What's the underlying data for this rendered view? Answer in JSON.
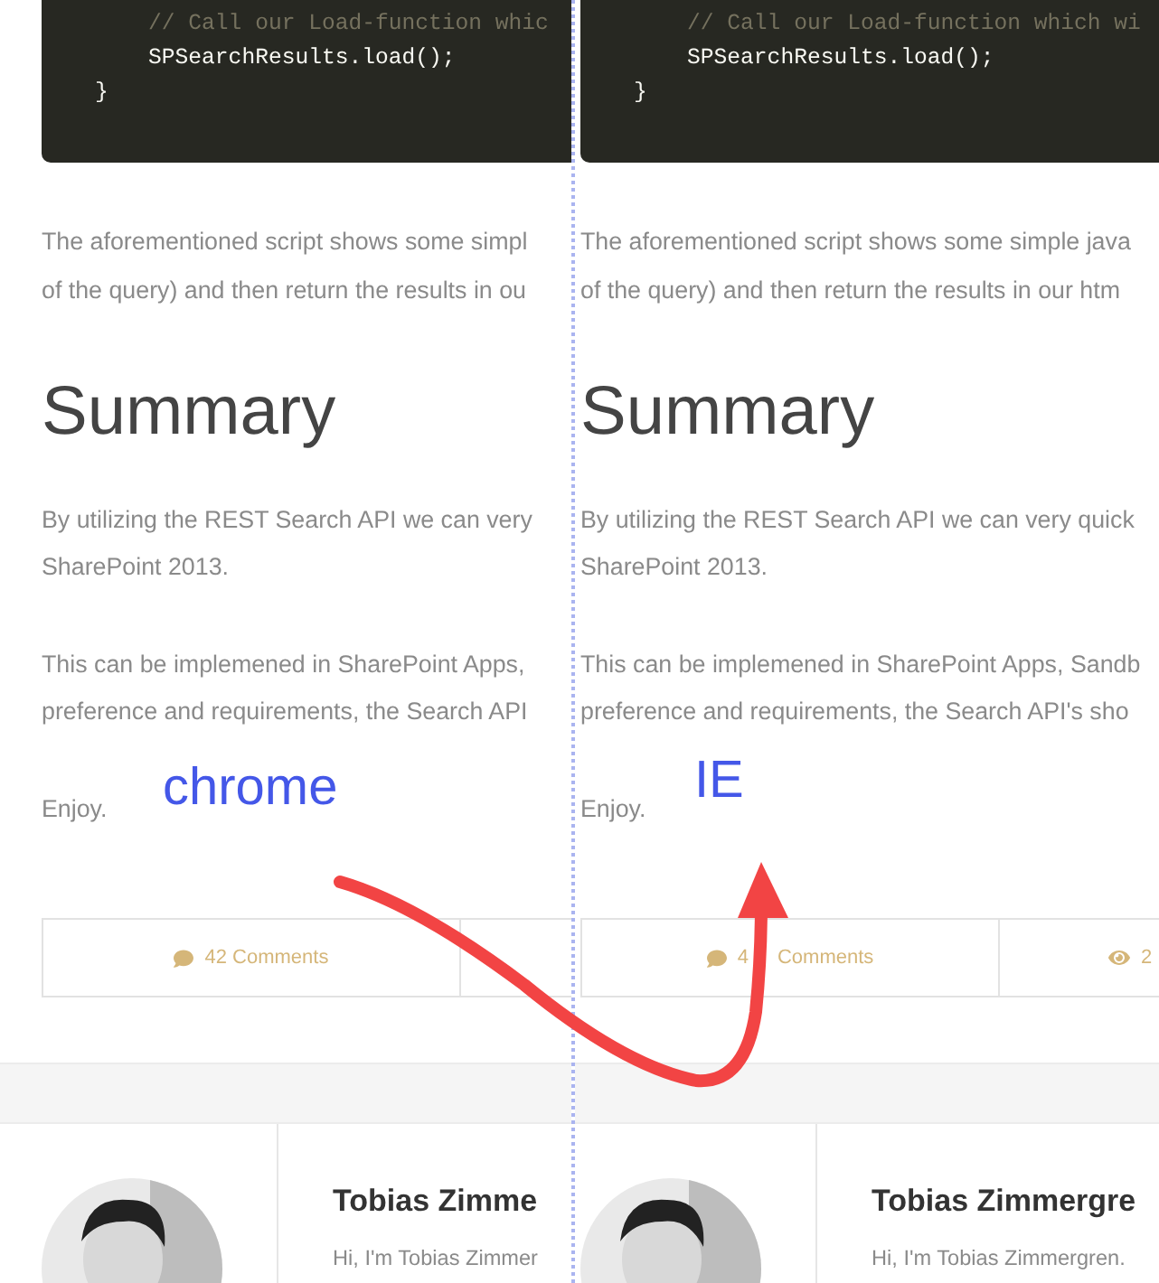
{
  "panes": [
    {
      "label": "chrome",
      "code_lines": [
        {
          "kind": "comment",
          "text": "        // Call our Load-function whic"
        },
        {
          "kind": "code",
          "text": "        SPSearchResults.load();"
        },
        {
          "kind": "code",
          "text": "    }"
        }
      ],
      "intro": [
        "The aforementioned script shows some simpl",
        "of the query) and then return the results in ou"
      ],
      "heading": "Summary",
      "paragraphs": [
        [
          "By utilizing the REST Search API we can very",
          "SharePoint 2013."
        ],
        [
          "This can be implemened in SharePoint Apps,",
          "preference and requirements, the Search API"
        ],
        [
          "Enjoy."
        ]
      ],
      "stats": [
        {
          "kind": "comments",
          "texts": [
            "42 Comments"
          ]
        },
        {
          "kind": "views"
        }
      ],
      "author": {
        "name": "Tobias Zimme",
        "bio": "Hi, I'm Tobias Zimmer"
      }
    },
    {
      "label": "IE",
      "code_lines": [
        {
          "kind": "comment",
          "text": "        // Call our Load-function which wi"
        },
        {
          "kind": "code",
          "text": "        SPSearchResults.load();"
        },
        {
          "kind": "code",
          "text": "    }"
        }
      ],
      "intro": [
        "The aforementioned script shows some simple java",
        "of the query) and then return the results in our htm"
      ],
      "heading": "Summary",
      "paragraphs": [
        [
          "By utilizing the REST Search API we can very quick",
          "SharePoint 2013."
        ],
        [
          "This can be implemened in SharePoint Apps, Sandb",
          "preference and requirements, the Search API's sho"
        ],
        [
          "Enjoy."
        ]
      ],
      "stats": [
        {
          "kind": "comments",
          "texts": [
            "4",
            "Comments"
          ]
        },
        {
          "kind": "views",
          "texts": [
            "2"
          ]
        }
      ],
      "author": {
        "name": "Tobias Zimmergre",
        "bio": "Hi, I'm Tobias Zimmergren."
      }
    }
  ]
}
